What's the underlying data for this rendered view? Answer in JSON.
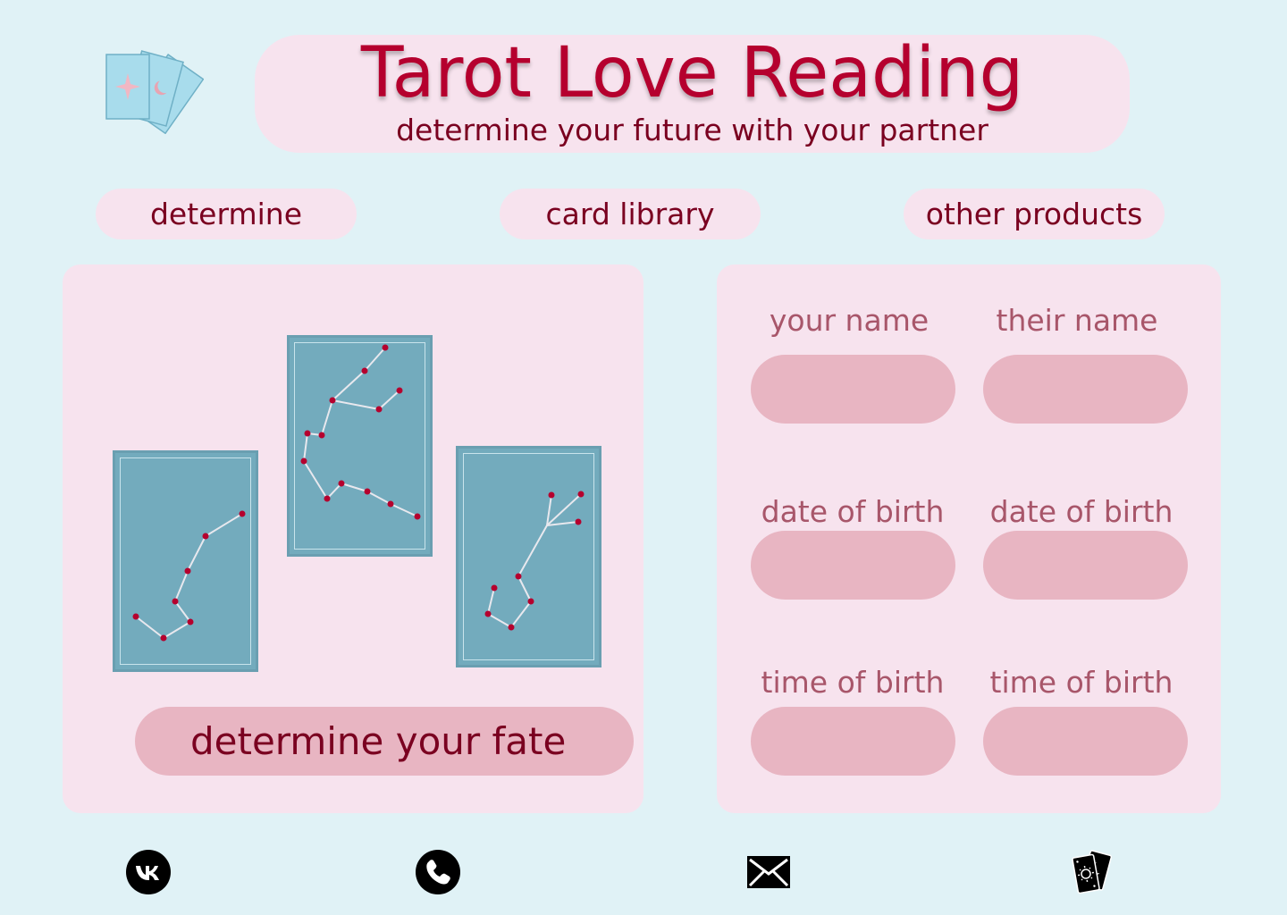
{
  "header": {
    "title": "Tarot Love Reading",
    "subtitle": "determine your future with your partner",
    "logo_icon": "tarot-cards-logo-icon"
  },
  "nav": {
    "items": [
      {
        "label": "determine"
      },
      {
        "label": "card library"
      },
      {
        "label": "other products"
      }
    ]
  },
  "cards": {
    "icons": [
      "constellation-card-icon",
      "constellation-card-icon",
      "constellation-card-icon"
    ],
    "action_label": "determine your fate"
  },
  "form": {
    "your": {
      "name_label": "your name",
      "dob_label": "date of birth",
      "tob_label": "time of birth",
      "name_value": "",
      "dob_value": "",
      "tob_value": ""
    },
    "their": {
      "name_label": "their name",
      "dob_label": "date of birth",
      "tob_label": "time of birth",
      "name_value": "",
      "dob_value": "",
      "tob_value": ""
    }
  },
  "footer": {
    "icons": [
      "vk-icon",
      "phone-icon",
      "mail-icon",
      "tarot-deck-icon"
    ]
  },
  "colors": {
    "background": "#e0f2f6",
    "panel": "#f7e3ee",
    "pill": "#e8b5c2",
    "title": "#b5002e",
    "text_dark": "#7a0020",
    "label": "#a8566a",
    "card": "#73abbd",
    "star": "#b5002e"
  }
}
